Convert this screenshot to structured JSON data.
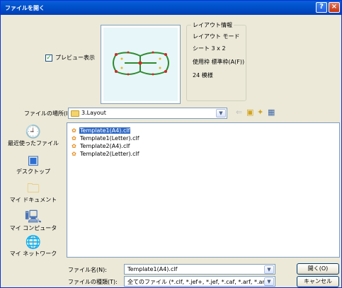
{
  "window": {
    "title": "ファイルを開く",
    "help_label": "?",
    "close_label": "×"
  },
  "preview": {
    "checkbox_label": "プレビュー表示",
    "checked": true
  },
  "layout_info": {
    "heading": "レイアウト情報",
    "lines": [
      "レイアウト モード",
      "シート  3 x 2",
      "使用枠  標準枠(A(F))",
      "24 模様"
    ]
  },
  "location": {
    "label": "ファイルの場所(I):",
    "value": "3.Layout"
  },
  "places": [
    {
      "label": "最近使ったファイル",
      "icon": "recent-icon"
    },
    {
      "label": "デスクトップ",
      "icon": "desktop-icon"
    },
    {
      "label": "マイ ドキュメント",
      "icon": "documents-icon"
    },
    {
      "label": "マイ コンピュータ",
      "icon": "computer-icon"
    },
    {
      "label": "マイ ネットワーク",
      "icon": "network-icon"
    }
  ],
  "files": [
    {
      "name": "Template1(A4).clf",
      "selected": true
    },
    {
      "name": "Template1(Letter).clf",
      "selected": false
    },
    {
      "name": "Template2(A4).clf",
      "selected": false
    },
    {
      "name": "Template2(Letter).clf",
      "selected": false
    }
  ],
  "filename": {
    "label": "ファイル名(N):",
    "value": "Template1(A4).clf"
  },
  "filetype": {
    "label": "ファイルの種類(T):",
    "value": "全てのファイル (*.clf, *.jef+, *.jef, *.caf, *.arf, *.arr)"
  },
  "buttons": {
    "open": "開く(O)",
    "cancel": "キャンセル"
  }
}
